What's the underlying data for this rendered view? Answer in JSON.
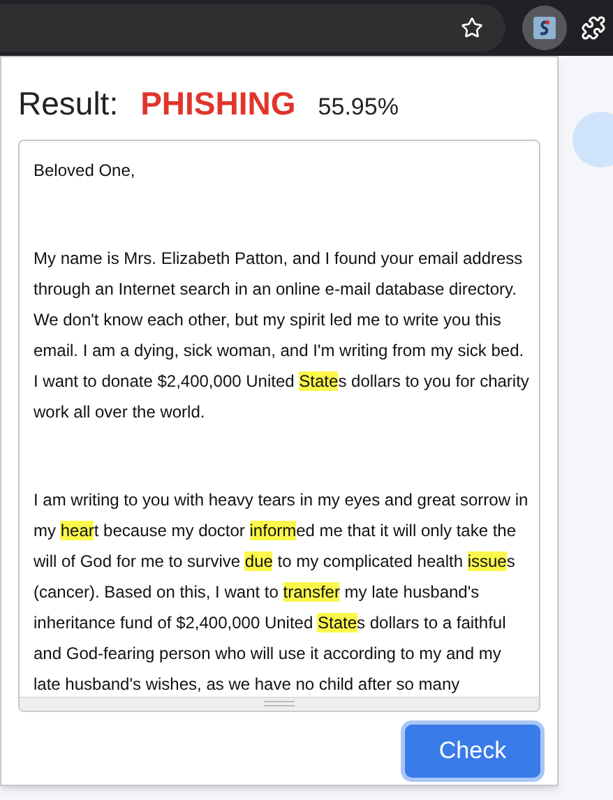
{
  "result": {
    "label": "Result:",
    "verdict": "PHISHING",
    "kind": "phishing",
    "score": "55.95%"
  },
  "message": {
    "paragraphs": [
      [
        {
          "text": "Beloved One,",
          "highlighted": false
        }
      ],
      [
        {
          "text": "My name is Mrs. Elizabeth Patton, and I found your email address through an Internet search in an online e-mail database directory. We don't know each other, but my spirit led me to write you this email. I am a dying, sick woman, and I'm writing from my sick bed. I want to donate $2,400,000 United ",
          "highlighted": false
        },
        {
          "text": "State",
          "highlighted": true
        },
        {
          "text": "s dollars to you for charity work all over the world.",
          "highlighted": false
        }
      ],
      [
        {
          "text": "I am writing to you with heavy tears in my eyes and great sorrow in my ",
          "highlighted": false
        },
        {
          "text": "hear",
          "highlighted": true
        },
        {
          "text": "t because my doctor ",
          "highlighted": false
        },
        {
          "text": "inform",
          "highlighted": true
        },
        {
          "text": "ed me that it will only take the will of God for me to survive ",
          "highlighted": false
        },
        {
          "text": "due",
          "highlighted": true
        },
        {
          "text": " to my complicated health ",
          "highlighted": false
        },
        {
          "text": "issue",
          "highlighted": true
        },
        {
          "text": "s (cancer). Based on this, I want to ",
          "highlighted": false
        },
        {
          "text": "transfer",
          "highlighted": true
        },
        {
          "text": " my late husband's inheritance fund of $2,400,000 United ",
          "highlighted": false
        },
        {
          "text": "State",
          "highlighted": true
        },
        {
          "text": "s dollars to a faithful and God-fearing person who will use it according to my and my late husband's wishes, as we have no child after so many",
          "highlighted": false
        }
      ]
    ]
  },
  "button": "Check"
}
